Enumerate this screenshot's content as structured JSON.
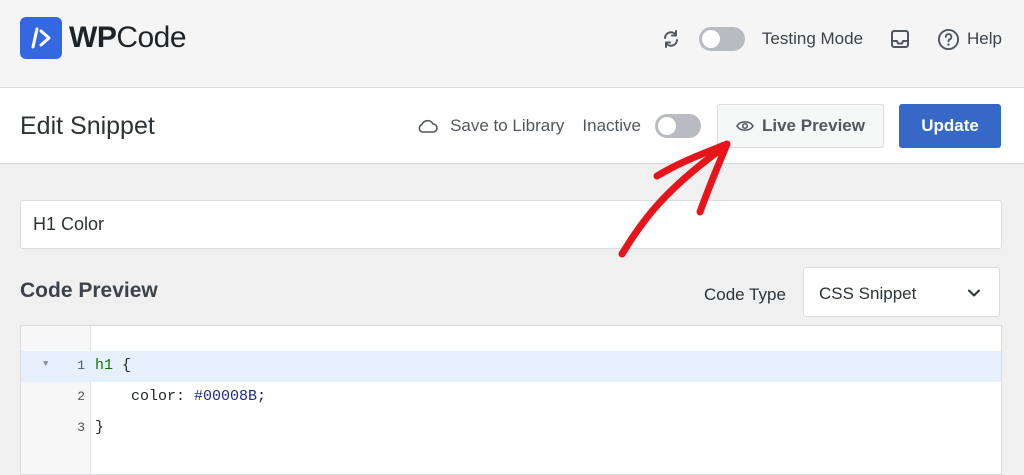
{
  "brand": {
    "logo_bold": "WP",
    "logo_regular": "Code"
  },
  "topbar": {
    "refresh_icon": "refresh-icon",
    "testing_mode_label": "Testing Mode",
    "inbox_icon": "inbox-icon",
    "help_label": "Help"
  },
  "header": {
    "title": "Edit Snippet",
    "save_to_library_label": "Save to Library",
    "status_label": "Inactive",
    "live_preview_label": "Live Preview",
    "update_label": "Update"
  },
  "snippet": {
    "name": "H1 Color",
    "section_title": "Code Preview",
    "code_type_label": "Code Type",
    "code_type_value": "CSS Snippet"
  },
  "editor": {
    "lines": [
      {
        "num": "1",
        "selector": "h1",
        "rest": " {"
      },
      {
        "num": "2",
        "prop": "    color: ",
        "value": "#00008B",
        "end": ";"
      },
      {
        "num": "3",
        "text": "}"
      }
    ]
  },
  "colors": {
    "accent": "#3568c7",
    "logo_blue": "#3568e0",
    "annotation_arrow": "#e8141b"
  }
}
